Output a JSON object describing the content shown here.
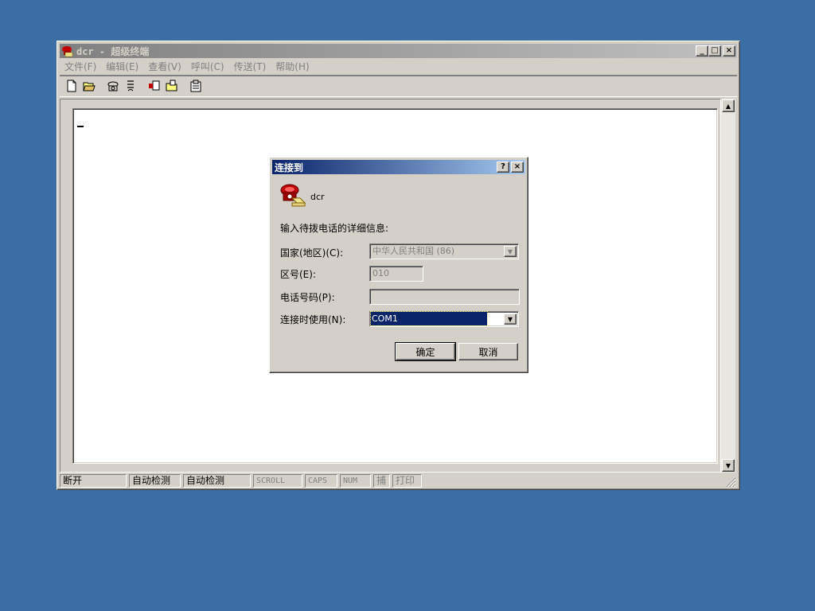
{
  "window": {
    "title": "dcr - 超级终端",
    "minimize": "_",
    "maximize": "□",
    "close": "×"
  },
  "menu": [
    {
      "label": "文件(F)"
    },
    {
      "label": "编辑(E)"
    },
    {
      "label": "查看(V)"
    },
    {
      "label": "呼叫(C)"
    },
    {
      "label": "传送(T)"
    },
    {
      "label": "帮助(H)"
    }
  ],
  "statusbar": {
    "connection": "断开",
    "detect1": "自动检测",
    "detect2": "自动检测",
    "scroll": "SCROLL",
    "caps": "CAPS",
    "num": "NUM",
    "capture": "捕",
    "print": "打印"
  },
  "dialog": {
    "title": "连接到",
    "help": "?",
    "close": "×",
    "connection_name": "dcr",
    "instruction": "输入待拨电话的详细信息:",
    "country_label": "国家(地区)(C):",
    "country_value": "中华人民共和国 (86)",
    "area_label": "区号(E):",
    "area_value": "010",
    "phone_label": "电话号码(P):",
    "phone_value": "",
    "connect_using_label": "连接时使用(N):",
    "connect_using_value": "COM1",
    "ok": "确定",
    "cancel": "取消"
  },
  "colors": {
    "desktop": "#3a6ea5",
    "face": "#d4d0c8",
    "active_title": "#0a246a",
    "selection": "#0a246a"
  }
}
